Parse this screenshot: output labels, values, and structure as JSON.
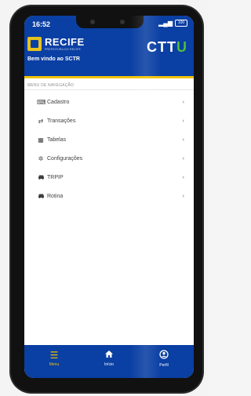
{
  "status_bar": {
    "time": "16:52",
    "battery": "100"
  },
  "header": {
    "brand": "RECIFE",
    "brand_sub": "PREFEITURA DO RECIFE",
    "logo_right_main": "CTT",
    "logo_right_last": "U",
    "welcome": "Bem vindo ao SCTR"
  },
  "menu": {
    "title": "MENU DE NAVEGAÇÃO",
    "items": [
      {
        "label": "Cadastro",
        "icon": "keyboard-icon"
      },
      {
        "label": "Transações",
        "icon": "swap-icon"
      },
      {
        "label": "Tabelas",
        "icon": "table-icon"
      },
      {
        "label": "Configurações",
        "icon": "gear-icon"
      },
      {
        "label": "TRPIP",
        "icon": "car-icon"
      },
      {
        "label": "Rotina",
        "icon": "car-icon"
      }
    ],
    "chevron": "‹"
  },
  "bottom_nav": {
    "items": [
      {
        "label": "Menu",
        "icon": "hamburger-icon"
      },
      {
        "label": "Início",
        "icon": "home-icon"
      },
      {
        "label": "Perfil",
        "icon": "user-icon"
      }
    ]
  },
  "colors": {
    "primary": "#0a3fa3",
    "accent": "#f2c300",
    "accent_green": "#4fbf3a"
  }
}
